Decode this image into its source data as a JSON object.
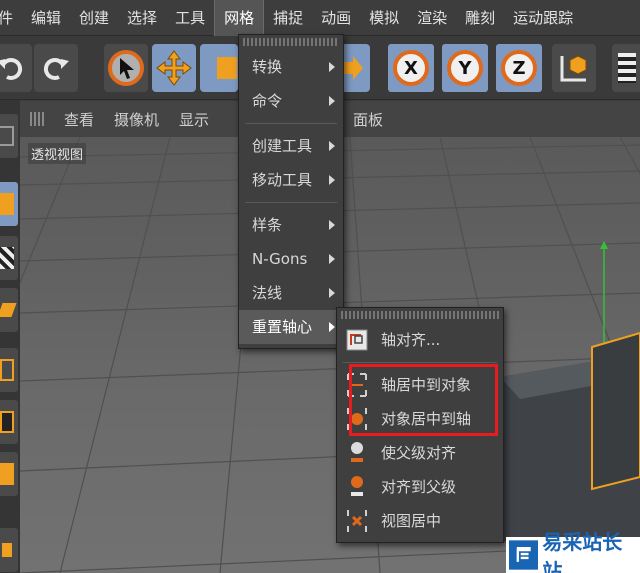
{
  "menubar": {
    "items": [
      "件",
      "编辑",
      "创建",
      "选择",
      "工具",
      "网格",
      "捕捉",
      "动画",
      "模拟",
      "渲染",
      "雕刻",
      "运动跟踪"
    ],
    "active": "网格"
  },
  "viewbar": {
    "items": [
      "查看",
      "摄像机",
      "显示",
      "面板"
    ]
  },
  "viewport": {
    "title": "透视视图"
  },
  "toolbar": {
    "axis_x": "X",
    "axis_y": "Y",
    "axis_z": "Z"
  },
  "mesh_menu": {
    "items": [
      {
        "label": "转换",
        "submenu": true
      },
      {
        "label": "命令",
        "submenu": true
      },
      {
        "label": "创建工具",
        "submenu": true
      },
      {
        "label": "移动工具",
        "submenu": true
      },
      {
        "label": "样条",
        "submenu": true
      },
      {
        "label": "N-Gons",
        "submenu": true
      },
      {
        "label": "法线",
        "submenu": true
      },
      {
        "label": "重置轴心",
        "submenu": true
      }
    ],
    "highlighted": "重置轴心"
  },
  "axis_submenu": {
    "items": [
      {
        "label": "轴对齐...",
        "icon": "axis-align-icon"
      },
      {
        "label": "轴居中到对象",
        "icon": "axis-center-object-icon"
      },
      {
        "label": "对象居中到轴",
        "icon": "object-center-axis-icon"
      },
      {
        "label": "使父级对齐",
        "icon": "parent-align-icon"
      },
      {
        "label": "对齐到父级",
        "icon": "align-to-parent-icon"
      },
      {
        "label": "视图居中",
        "icon": "view-center-icon"
      }
    ]
  },
  "watermark": {
    "text": "易采站长站"
  },
  "colors": {
    "accent_orange": "#e06a1c",
    "highlight_red": "#e81c1c",
    "button_blue": "#7e99c2",
    "watermark_blue": "#1a64b4"
  }
}
